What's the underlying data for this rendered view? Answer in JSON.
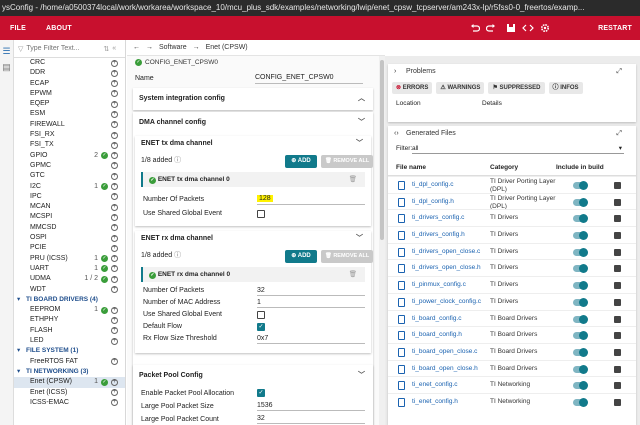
{
  "window": {
    "title": "ysConfig - /home/a0500374local/work/workarea/workspace_10/mcu_plus_sdk/examples/networking/lwip/enet_cpsw_tcpserver/am243x-lp/r5fss0-0_freertos/examp..."
  },
  "menu": {
    "file": "FILE",
    "about": "ABOUT",
    "restart": "RESTART"
  },
  "tree": {
    "filter_placeholder": "Type Filter Text...",
    "items": [
      {
        "label": "CRC",
        "type": "item"
      },
      {
        "label": "DDR",
        "type": "item"
      },
      {
        "label": "ECAP",
        "type": "item"
      },
      {
        "label": "EPWM",
        "type": "item"
      },
      {
        "label": "EQEP",
        "type": "item"
      },
      {
        "label": "ESM",
        "type": "item"
      },
      {
        "label": "FIREWALL",
        "type": "item"
      },
      {
        "label": "FSI_RX",
        "type": "item"
      },
      {
        "label": "FSI_TX",
        "type": "item"
      },
      {
        "label": "GPIO",
        "type": "item",
        "count": "2"
      },
      {
        "label": "GPMC",
        "type": "item"
      },
      {
        "label": "GTC",
        "type": "item"
      },
      {
        "label": "I2C",
        "type": "item",
        "count": "1"
      },
      {
        "label": "IPC",
        "type": "item"
      },
      {
        "label": "MCAN",
        "type": "item"
      },
      {
        "label": "MCSPI",
        "type": "item"
      },
      {
        "label": "MMCSD",
        "type": "item"
      },
      {
        "label": "OSPI",
        "type": "item"
      },
      {
        "label": "PCIE",
        "type": "item"
      },
      {
        "label": "PRU (ICSS)",
        "type": "item",
        "count": "1"
      },
      {
        "label": "UART",
        "type": "item",
        "count": "1"
      },
      {
        "label": "UDMA",
        "type": "item",
        "count": "1 / 2"
      },
      {
        "label": "WDT",
        "type": "item"
      },
      {
        "label": "TI BOARD DRIVERS (4)",
        "type": "section"
      },
      {
        "label": "EEPROM",
        "type": "item",
        "count": "1"
      },
      {
        "label": "ETHPHY",
        "type": "item"
      },
      {
        "label": "FLASH",
        "type": "item"
      },
      {
        "label": "LED",
        "type": "item"
      },
      {
        "label": "FILE SYSTEM (1)",
        "type": "section"
      },
      {
        "label": "FreeRTOS FAT",
        "type": "item"
      },
      {
        "label": "TI NETWORKING (3)",
        "type": "section"
      },
      {
        "label": "Enet (CPSW)",
        "type": "item",
        "count": "1",
        "selected": true
      },
      {
        "label": "Enet (ICSS)",
        "type": "item"
      },
      {
        "label": "ICSS-EMAC",
        "type": "item"
      }
    ]
  },
  "breadcrumb": {
    "parent": "Software",
    "separator": "→",
    "current": "Enet (CPSW)"
  },
  "config": {
    "instance_name": "CONFIG_ENET_CPSW0",
    "name_label": "Name",
    "name_value": "CONFIG_ENET_CPSW0",
    "system_integration": "System integration config",
    "dma_config": "DMA channel config",
    "tx_channel": {
      "title": "ENET tx dma channel",
      "added": "1/8 added",
      "add": "ADD",
      "remove": "REMOVE ALL",
      "instance": "ENET tx dma channel 0",
      "packets_label": "Number Of Packets",
      "packets_value": "128",
      "shared_label": "Use Shared Global Event"
    },
    "rx_channel": {
      "title": "ENET rx dma channel",
      "added": "1/8 added",
      "add": "ADD",
      "remove": "REMOVE ALL",
      "instance": "ENET rx dma channel 0",
      "packets_label": "Number Of Packets",
      "packets_value": "32",
      "mac_label": "Number of MAC Address",
      "mac_value": "1",
      "shared_label": "Use Shared Global Event",
      "default_flow_label": "Default Flow",
      "rx_size_label": "Rx Flow Size Threshold",
      "rx_size_value": "0x7"
    },
    "packet_pool": {
      "title": "Packet Pool Config",
      "enable_label": "Enable Packet Pool Allocation",
      "large_size_label": "Large Pool Packet Size",
      "large_size_value": "1536",
      "large_count_label": "Large Pool Packet Count",
      "large_count_value": "32"
    }
  },
  "problems": {
    "title": "Problems",
    "errors": "ERRORS",
    "warnings": "WARNINGS",
    "suppressed": "SUPPRESSED",
    "infos": "INFOS",
    "col_location": "Location",
    "col_details": "Details"
  },
  "generated": {
    "title": "Generated Files",
    "filter_label": "Filter:",
    "filter_value": "all",
    "col_file": "File name",
    "col_category": "Category",
    "col_build": "Include in build",
    "files": [
      {
        "name": "ti_dpl_config.c",
        "category": "TI Driver Porting Layer (DPL)"
      },
      {
        "name": "ti_dpl_config.h",
        "category": "TI Driver Porting Layer (DPL)"
      },
      {
        "name": "ti_drivers_config.c",
        "category": "TI Drivers"
      },
      {
        "name": "ti_drivers_config.h",
        "category": "TI Drivers"
      },
      {
        "name": "ti_drivers_open_close.c",
        "category": "TI Drivers"
      },
      {
        "name": "ti_drivers_open_close.h",
        "category": "TI Drivers"
      },
      {
        "name": "ti_pinmux_config.c",
        "category": "TI Drivers"
      },
      {
        "name": "ti_power_clock_config.c",
        "category": "TI Drivers"
      },
      {
        "name": "ti_board_config.c",
        "category": "TI Board Drivers"
      },
      {
        "name": "ti_board_config.h",
        "category": "TI Board Drivers"
      },
      {
        "name": "ti_board_open_close.c",
        "category": "TI Board Drivers"
      },
      {
        "name": "ti_board_open_close.h",
        "category": "TI Board Drivers"
      },
      {
        "name": "ti_enet_config.c",
        "category": "TI Networking"
      },
      {
        "name": "ti_enet_config.h",
        "category": "TI Networking"
      }
    ]
  }
}
